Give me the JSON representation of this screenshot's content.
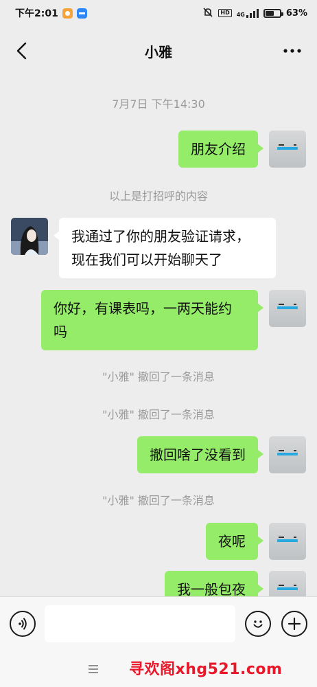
{
  "status_bar": {
    "time": "下午2:01",
    "network": "4G",
    "battery": "63%",
    "battery_level": 0.63,
    "icons": [
      "orange-app-icon",
      "blue-app-icon",
      "mute-alarm-icon",
      "hd-icon",
      "signal-icon",
      "battery-icon"
    ]
  },
  "nav": {
    "title": "小雅",
    "back_icon": "chevron-left-icon",
    "more_icon": "more-dots-icon"
  },
  "messages": [
    {
      "type": "time",
      "text": "7月7日 下午14:30"
    },
    {
      "type": "me",
      "text": "朋友介绍"
    },
    {
      "type": "system",
      "text": "以上是打招呼的内容"
    },
    {
      "type": "other",
      "line1": "我通过了你的朋友验证请求，",
      "line2": "现在我们可以开始聊天了"
    },
    {
      "type": "me",
      "line1": "你好，有课表吗，一两天能约",
      "line2": "吗"
    },
    {
      "type": "system",
      "text": "\"小雅\" 撤回了一条消息"
    },
    {
      "type": "system",
      "text": "\"小雅\" 撤回了一条消息"
    },
    {
      "type": "me",
      "text": "撤回啥了没看到"
    },
    {
      "type": "system",
      "text": "\"小雅\" 撤回了一条消息"
    },
    {
      "type": "me",
      "text": "夜呢"
    },
    {
      "type": "me",
      "text": "我一般包夜"
    }
  ],
  "input_bar": {
    "voice_icon": "voice-icon",
    "emoji_icon": "emoji-icon",
    "plus_icon": "plus-icon",
    "placeholder": ""
  },
  "system_nav": {
    "menu_icon": "menu-icon",
    "watermark": "寻欢阁xhg521.com"
  },
  "colors": {
    "background": "#ededed",
    "bubble_me": "#95ec69",
    "bubble_other": "#ffffff",
    "watermark": "#e8172a"
  }
}
